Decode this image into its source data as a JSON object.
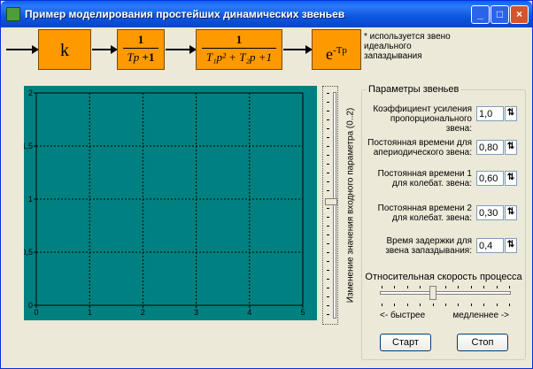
{
  "window": {
    "title": "Пример моделирования простейших динамических звеньев",
    "buttons": {
      "minimize": "_",
      "maximize": "□",
      "close": "×"
    }
  },
  "diagram": {
    "block1": "k",
    "block2": {
      "num": "1",
      "den_p": "Tp",
      "den_rest": " +1"
    },
    "block3": {
      "num": "1",
      "den": "T₁p² + T₂p +1"
    },
    "block4": {
      "base": "e",
      "exp": "-Tp"
    },
    "note": "* используется звено идеального запаздывания"
  },
  "chart_data": {
    "type": "line",
    "x_ticks": [
      "0",
      "1",
      "2",
      "3",
      "4",
      "5"
    ],
    "y_ticks": [
      "0",
      "0,5",
      "1",
      "1,5",
      "2"
    ],
    "xlim": [
      0,
      5
    ],
    "ylim": [
      0,
      2
    ],
    "grid": true,
    "series": []
  },
  "input_slider": {
    "label": "Изменение значения входного параметра (0..2)",
    "value": 1
  },
  "params": {
    "title": "Параметры звеньев",
    "rows": [
      {
        "label": "Коэффициент усиления пропорционального звена:",
        "value": "1,0"
      },
      {
        "label": "Постоянная времени для апериодического звена:",
        "value": "0,80"
      },
      {
        "label": "Постоянная времени 1 для колебат. звена:",
        "value": "0,60"
      },
      {
        "label": "Постоянная времени 2 для колебат. звена:",
        "value": "0,30"
      },
      {
        "label": "Время задержки для звена запаздывания:",
        "value": "0,4"
      }
    ],
    "spin_symbol": "⇅"
  },
  "speed": {
    "title": "Относительная скорость процесса",
    "fast": "<- быстрее",
    "slow": "медленнее ->",
    "value": 0.4
  },
  "actions": {
    "start": "Старт",
    "stop": "Стоп"
  },
  "colors": {
    "block": "#FF9900",
    "plot_bg": "#008080",
    "title_bar": "#0A5FF5"
  }
}
